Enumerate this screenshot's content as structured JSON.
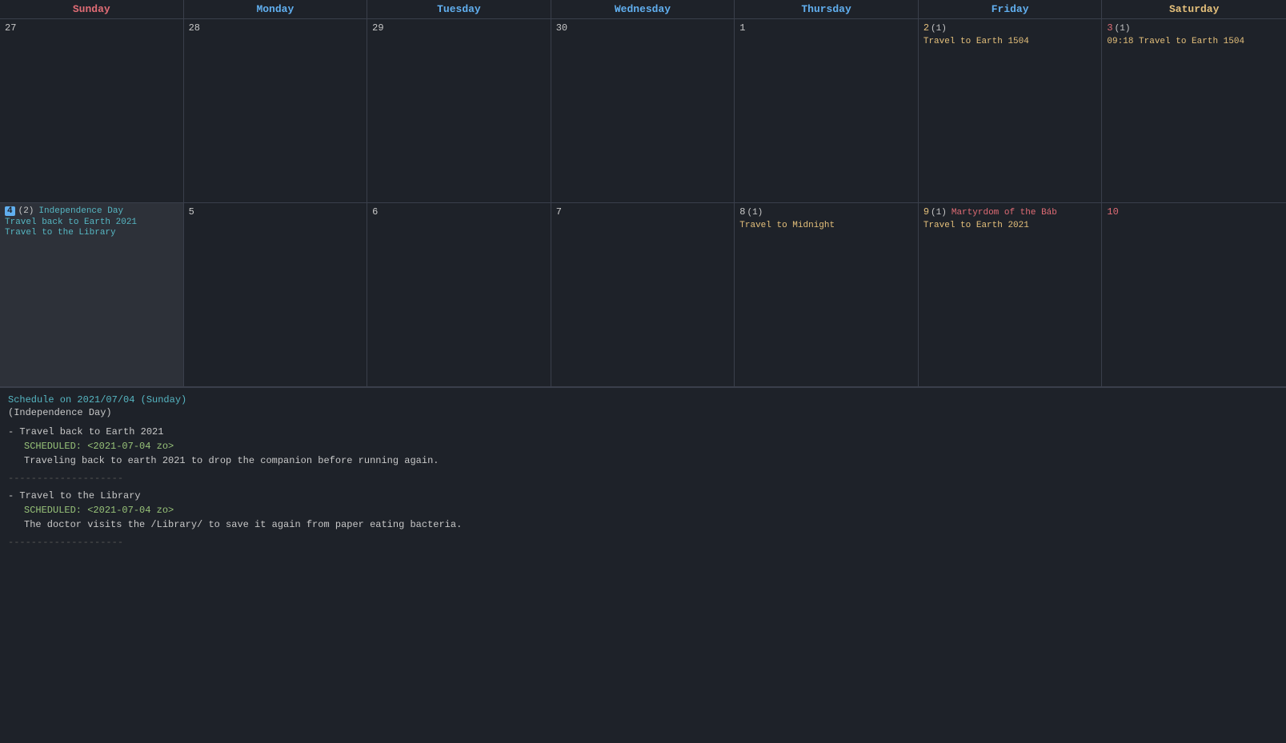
{
  "calendar": {
    "headers": [
      {
        "label": "Sunday",
        "class": "header-sunday"
      },
      {
        "label": "Monday",
        "class": "header-monday"
      },
      {
        "label": "Tuesday",
        "class": "header-tuesday"
      },
      {
        "label": "Wednesday",
        "class": "header-wednesday"
      },
      {
        "label": "Thursday",
        "class": "header-thursday"
      },
      {
        "label": "Friday",
        "class": "header-friday"
      },
      {
        "label": "Saturday",
        "class": "header-saturday"
      }
    ],
    "week1": [
      {
        "day": "27",
        "dayClass": "day-number",
        "events": [],
        "dim": true
      },
      {
        "day": "28",
        "dayClass": "day-number",
        "events": [],
        "dim": true
      },
      {
        "day": "29",
        "dayClass": "day-number",
        "events": [],
        "dim": true
      },
      {
        "day": "30",
        "dayClass": "day-number",
        "events": [],
        "dim": true
      },
      {
        "day": "1",
        "dayClass": "day-number",
        "events": []
      },
      {
        "day": "2",
        "count": "(1)",
        "dayClass": "day-number orange-num",
        "events": [
          {
            "label": "Travel to Earth 1504",
            "color": "orange"
          }
        ]
      },
      {
        "day": "3",
        "count": "(1)",
        "dayClass": "day-number red-num",
        "events": [
          {
            "label": "09:18 Travel to Earth 1504",
            "color": "orange"
          }
        ]
      }
    ],
    "week2": [
      {
        "day": "4",
        "badge": true,
        "count": "(2)",
        "holiday": "Independence Day",
        "selected": true,
        "dayClass": "day-number",
        "events": [
          {
            "label": "Travel back to Earth 2021",
            "color": "cyan"
          },
          {
            "label": "Travel to the Library",
            "color": "cyan"
          }
        ]
      },
      {
        "day": "5",
        "dayClass": "day-number",
        "events": []
      },
      {
        "day": "6",
        "dayClass": "day-number",
        "events": []
      },
      {
        "day": "7",
        "dayClass": "day-number",
        "events": []
      },
      {
        "day": "8",
        "count": "(1)",
        "dayClass": "day-number",
        "events": [
          {
            "label": "Travel to Midnight",
            "color": "orange"
          }
        ]
      },
      {
        "day": "9",
        "count": "(1)",
        "holiday": "Martyrdom of the Báb",
        "dayClass": "day-number orange-num",
        "events": [
          {
            "label": "Travel to Earth 2021",
            "color": "orange"
          }
        ]
      },
      {
        "day": "10",
        "dayClass": "day-number red-num",
        "events": []
      }
    ]
  },
  "schedule": {
    "title": "Schedule on 2021/07/04 (Sunday)",
    "subtitle": "(Independence Day)",
    "entries": [
      {
        "title": "- Travel back to Earth 2021",
        "scheduled": "SCHEDULED: <2021-07-04 zo>",
        "description": "Traveling back to earth 2021 to drop the companion before running again."
      },
      {
        "title": "- Travel to the Library",
        "scheduled": "SCHEDULED: <2021-07-04 zo>",
        "description": "The doctor visits the /Library/ to save it again from paper eating bacteria."
      }
    ],
    "divider": "--------------------"
  }
}
